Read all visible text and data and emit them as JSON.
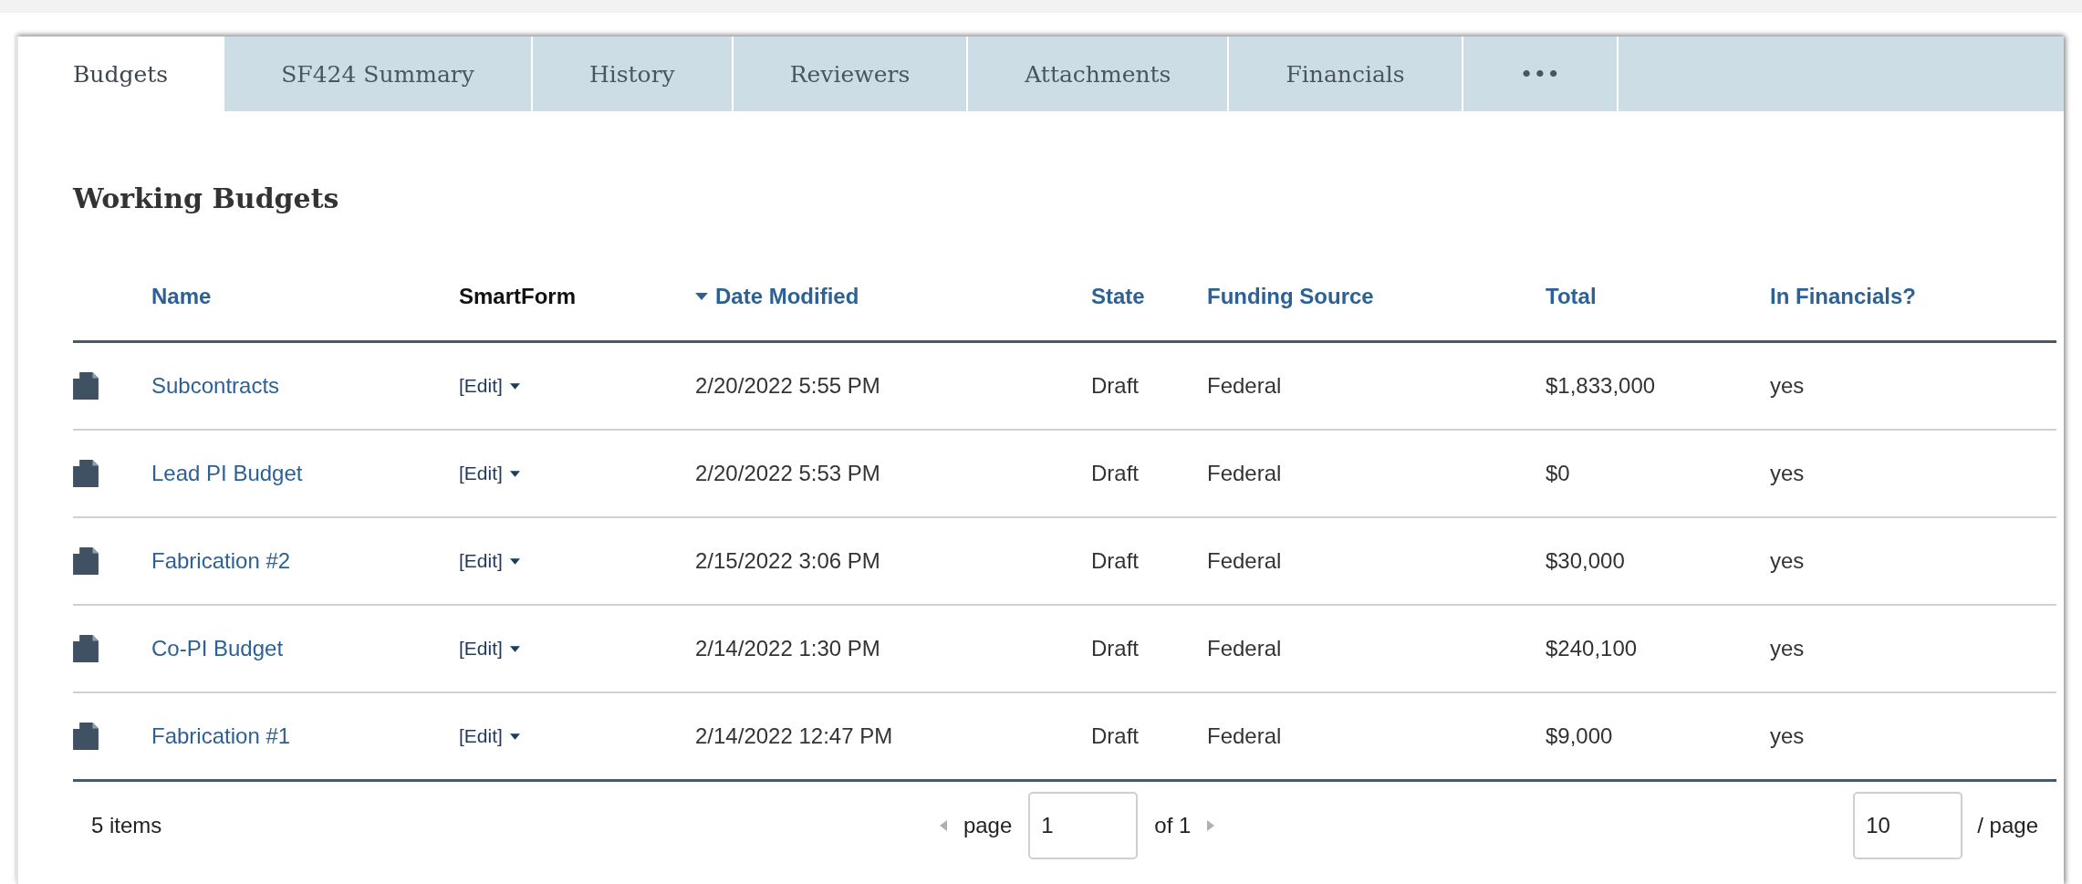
{
  "tabs": [
    {
      "label": "Budgets",
      "selected": true
    },
    {
      "label": "SF424 Summary",
      "selected": false
    },
    {
      "label": "History",
      "selected": false
    },
    {
      "label": "Reviewers",
      "selected": false
    },
    {
      "label": "Attachments",
      "selected": false
    },
    {
      "label": "Financials",
      "selected": false
    },
    {
      "label": "•••",
      "selected": false
    }
  ],
  "heading": "Working Budgets",
  "table": {
    "columns": [
      {
        "label": "Name",
        "sortable": true,
        "sorted": false
      },
      {
        "label": "SmartForm",
        "sortable": false,
        "sorted": false
      },
      {
        "label": "Date Modified",
        "sortable": true,
        "sorted": true
      },
      {
        "label": "State",
        "sortable": true,
        "sorted": false
      },
      {
        "label": "Funding Source",
        "sortable": true,
        "sorted": false
      },
      {
        "label": "Total",
        "sortable": true,
        "sorted": false
      },
      {
        "label": "In Financials?",
        "sortable": true,
        "sorted": false
      }
    ],
    "rows": [
      {
        "name": "Subcontracts",
        "smartform": "[Edit]",
        "date_modified": "2/20/2022 5:55 PM",
        "state": "Draft",
        "funding_source": "Federal",
        "total": "$1,833,000",
        "in_financials": "yes"
      },
      {
        "name": "Lead PI Budget",
        "smartform": "[Edit]",
        "date_modified": "2/20/2022 5:53 PM",
        "state": "Draft",
        "funding_source": "Federal",
        "total": "$0",
        "in_financials": "yes"
      },
      {
        "name": "Fabrication #2",
        "smartform": "[Edit]",
        "date_modified": "2/15/2022 3:06 PM",
        "state": "Draft",
        "funding_source": "Federal",
        "total": "$30,000",
        "in_financials": "yes"
      },
      {
        "name": "Co-PI Budget",
        "smartform": "[Edit]",
        "date_modified": "2/14/2022 1:30 PM",
        "state": "Draft",
        "funding_source": "Federal",
        "total": "$240,100",
        "in_financials": "yes"
      },
      {
        "name": "Fabrication #1",
        "smartform": "[Edit]",
        "date_modified": "2/14/2022 12:47 PM",
        "state": "Draft",
        "funding_source": "Federal",
        "total": "$9,000",
        "in_financials": "yes"
      }
    ]
  },
  "pagination": {
    "item_count": "5 items",
    "page_label": "page",
    "page_value": "1",
    "of_label": "of 1",
    "previous_disabled": true,
    "next_disabled": true,
    "per_page_value": "10",
    "per_page_label": "/ page"
  }
}
